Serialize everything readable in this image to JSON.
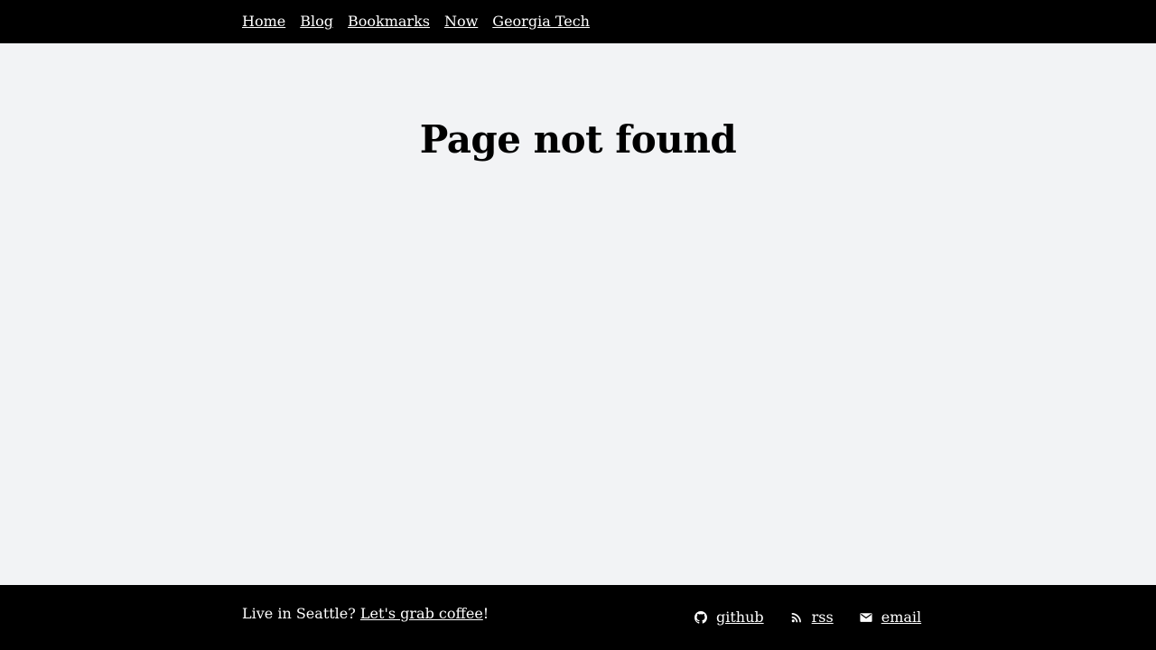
{
  "nav": {
    "items": [
      {
        "label": "Home"
      },
      {
        "label": "Blog"
      },
      {
        "label": "Bookmarks"
      },
      {
        "label": "Now"
      },
      {
        "label": "Georgia Tech"
      }
    ]
  },
  "main": {
    "title": "Page not found"
  },
  "footer": {
    "prefix": "Live in Seattle? ",
    "coffee_link": "Let's grab coffee",
    "suffix": "!",
    "links": [
      {
        "label": "github",
        "icon": "github-icon"
      },
      {
        "label": "rss",
        "icon": "rss-icon"
      },
      {
        "label": "email",
        "icon": "mail-icon"
      }
    ]
  },
  "colors": {
    "bar": "#000000",
    "page_bg": "#f2f3f5",
    "text_on_bar": "#ffffff"
  }
}
